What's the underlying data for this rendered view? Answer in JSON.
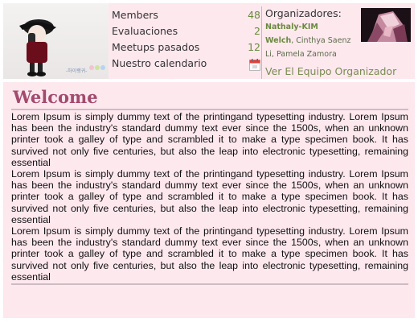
{
  "header": {
    "stats": [
      {
        "label": "Members",
        "value": "48"
      },
      {
        "label": "Evaluaciones",
        "value": "2"
      },
      {
        "label": "Meetups pasados",
        "value": "12"
      },
      {
        "label": "Nuestro calendario",
        "value": ""
      }
    ],
    "calendar_icon": "calendar-icon",
    "organizers": {
      "title": "Organizadores:",
      "name_1": "Nathaly-KIM",
      "name_2": "Welch",
      "rest": ", Cinthya Saenz Li, Pamela Zamora",
      "link": "Ver El Equipo Organizador"
    },
    "photo_caption": "-하이랭귀-"
  },
  "main": {
    "title": "Welcome",
    "paragraphs": [
      "Lorem Ipsum is simply dummy text of the printingand typesetting industry. Lorem Ipsum has been the industry's standard dummy text ever since the 1500s, when an unknown printer took a galley of type and scrambled it to make a type specimen book. It has survived not only five centuries, but also the leap into electronic typesetting, remaining essential",
      "Lorem Ipsum is simply dummy text of the printingand typesetting industry. Lorem Ipsum has been the industry's standard dummy text ever since the 1500s, when an unknown printer took a galley of type and scrambled it to make a type specimen book. It has survived not only five centuries, but also the leap into electronic typesetting, remaining essential",
      "Lorem Ipsum is simply dummy text of the printingand typesetting industry. Lorem Ipsum has been the industry's standard dummy text ever since the 1500s, when an unknown printer took a galley of type and scrambled it to make a type specimen book. It has survived not only five centuries, but also the leap into electronic typesetting, remaining essential"
    ]
  },
  "colors": {
    "panel_bg": "#fde8ee",
    "title": "#a34a6e",
    "accent_green": "#6a8a3e"
  }
}
